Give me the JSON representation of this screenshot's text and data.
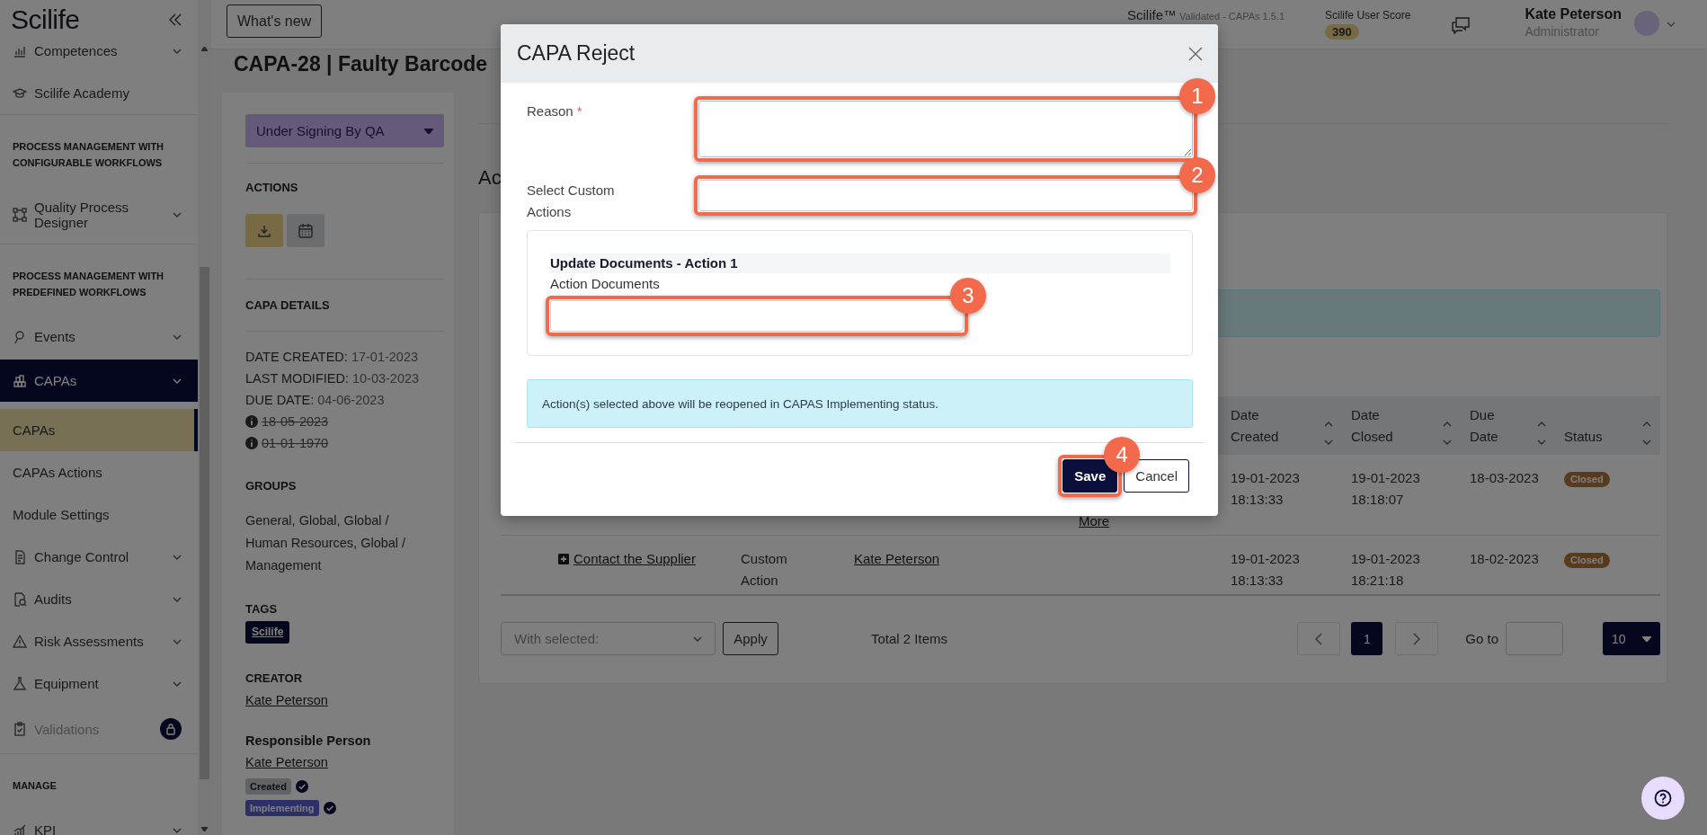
{
  "sidebar": {
    "logo": "Scilife",
    "items": [
      {
        "kind": "item",
        "label": "Competences",
        "has_submenu": true,
        "selected": false,
        "disabled": false,
        "locked": false
      },
      {
        "kind": "item",
        "label": "Scilife Academy",
        "has_submenu": false,
        "selected": false,
        "disabled": false,
        "locked": false
      },
      {
        "kind": "section",
        "label": "PROCESS MANAGEMENT WITH CONFIGURABLE WORKFLOWS"
      },
      {
        "kind": "item",
        "label": "Quality Process Designer",
        "has_submenu": true,
        "selected": false,
        "disabled": false,
        "locked": false
      },
      {
        "kind": "section",
        "label": "PROCESS MANAGEMENT WITH PREDEFINED WORKFLOWS"
      },
      {
        "kind": "item",
        "label": "Events",
        "has_submenu": true,
        "selected": false,
        "disabled": false,
        "locked": false
      },
      {
        "kind": "item",
        "label": "CAPAs",
        "has_submenu": true,
        "selected": true,
        "disabled": false,
        "locked": false
      },
      {
        "kind": "sub",
        "label": "CAPAs",
        "has_submenu": false,
        "selected": true,
        "disabled": false,
        "locked": false
      },
      {
        "kind": "sub",
        "label": "CAPAs Actions",
        "has_submenu": false,
        "selected": false,
        "disabled": false,
        "locked": false
      },
      {
        "kind": "sub",
        "label": "Module Settings",
        "has_submenu": false,
        "selected": false,
        "disabled": false,
        "locked": false
      },
      {
        "kind": "item",
        "label": "Change Control",
        "has_submenu": true,
        "selected": false,
        "disabled": false,
        "locked": false
      },
      {
        "kind": "item",
        "label": "Audits",
        "has_submenu": true,
        "selected": false,
        "disabled": false,
        "locked": false
      },
      {
        "kind": "item",
        "label": "Risk Assessments",
        "has_submenu": true,
        "selected": false,
        "disabled": false,
        "locked": false
      },
      {
        "kind": "item",
        "label": "Equipment",
        "has_submenu": true,
        "selected": false,
        "disabled": false,
        "locked": false
      },
      {
        "kind": "item",
        "label": "Validations",
        "has_submenu": false,
        "selected": false,
        "disabled": true,
        "locked": true
      },
      {
        "kind": "section",
        "label": "MANAGE"
      },
      {
        "kind": "item",
        "label": "KPI",
        "has_submenu": true,
        "selected": false,
        "disabled": false,
        "locked": false
      }
    ]
  },
  "topbar": {
    "whats_new": "What's new",
    "version_brand": "Scilife™",
    "version_text": "Validated - CAPAs 1.5.1",
    "score_label": "Scilife User Score",
    "score": "390",
    "user_name": "Kate Peterson",
    "user_role": "Administrator"
  },
  "page": {
    "title": "CAPA-28 | Faulty Barcode"
  },
  "details": {
    "status": "Under Signing By QA",
    "actions_heading": "ACTIONS",
    "details_heading": "CAPA DETAILS",
    "dates": [
      {
        "label": "DATE CREATED:",
        "value": "17-01-2023",
        "struck": false
      },
      {
        "label": "LAST MODIFIED:",
        "value": "10-03-2023",
        "struck": false
      },
      {
        "label": "DUE DATE:",
        "value": "04-06-2023",
        "struck": false
      },
      {
        "value": "18-05-2023",
        "struck": true
      },
      {
        "value": "01-01-1970",
        "struck": true
      }
    ],
    "groups_heading": "GROUPS",
    "groups": "General, Global, Global / Human Resources, Global / Management",
    "tags_heading": "TAGS",
    "tags": [
      "Scilife"
    ],
    "creator_heading": "CREATOR",
    "creator": "Kate Peterson",
    "responsible_heading": "Responsible Person",
    "responsible": "Kate Peterson",
    "statuses": [
      {
        "label": "Created",
        "kind": "created",
        "done": true
      },
      {
        "label": "Implementing",
        "kind": "implementing",
        "done": true
      }
    ]
  },
  "main": {
    "heading": "Ac",
    "table": {
      "columns": [
        {
          "label": "Date Created"
        },
        {
          "label": "Date Closed"
        },
        {
          "label": "Due Date"
        },
        {
          "label": "Status"
        }
      ],
      "rows": [
        {
          "more_link": "More",
          "date_created": "19-01-2023 18:13:33",
          "date_closed": "19-01-2023 18:18:07",
          "due_date": "18-03-2023",
          "status": "Closed"
        },
        {
          "title": "Contact the Supplier",
          "type": "Custom Action",
          "owner": "Kate Peterson",
          "date_created": "19-01-2023 18:13:33",
          "date_closed": "19-01-2023 18:21:18",
          "due_date": "18-02-2023",
          "status": "Closed"
        }
      ]
    },
    "footer": {
      "bulk_placeholder": "With selected:",
      "apply": "Apply",
      "total": "Total 2 Items",
      "pages": [
        {
          "label": "1",
          "selected": true
        }
      ],
      "goto_label": "Go to",
      "page_size": "10"
    }
  },
  "modal": {
    "title": "CAPA Reject",
    "fields": [
      {
        "kind": "textarea",
        "label": "Reason",
        "required_mark": "*",
        "callout": "1"
      },
      {
        "kind": "select",
        "label": "Select Custom Actions",
        "callout": "2"
      }
    ],
    "action_group": {
      "title": "Update Documents - Action 1",
      "field_label": "Action Documents",
      "callout": "3"
    },
    "info": "Action(s) selected above will be reopened in CAPAS Implementing status.",
    "buttons": [
      {
        "label": "Save",
        "kind": "primary",
        "callout": "4"
      },
      {
        "label": "Cancel",
        "kind": "secondary"
      }
    ]
  }
}
